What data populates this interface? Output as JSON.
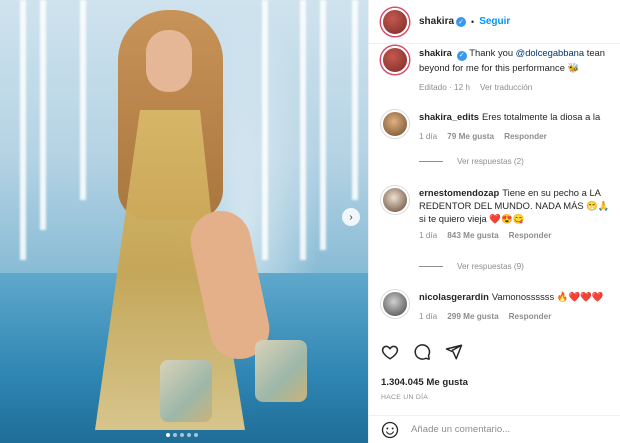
{
  "post": {
    "username": "shakira",
    "follow_label": "Seguir",
    "caption_user": "shakira",
    "caption_prefix": "Thank you ",
    "caption_mention": "@dolcegabbana",
    "caption_suffix": " tean",
    "caption_line2": "beyond for me for this performance 🐝",
    "caption_meta_edited": "Editado · 12 h",
    "caption_meta_translate": "Ver traducción"
  },
  "comments": [
    {
      "username": "shakira_edits",
      "text": "Eres totalmente la diosa a la",
      "time": "1 día",
      "likes": "79 Me gusta",
      "reply_label": "Responder",
      "view_replies": "Ver respuestas (2)"
    },
    {
      "username": "ernestomendozap",
      "text_line1": "Tiene en su pecho a LA",
      "text_line2": "REDENTOR DEL MUNDO. NADA MÁS 😁🙏",
      "text_line3": "si te quiero vieja ❤️😍😋",
      "time": "1 día",
      "likes": "843 Me gusta",
      "reply_label": "Responder",
      "view_replies": "Ver respuestas (9)"
    },
    {
      "username": "nicolasgerardin",
      "text": "Vamonossssss 🔥❤️❤️❤️",
      "time": "1 día",
      "likes": "299 Me gusta",
      "reply_label": "Responder"
    }
  ],
  "stats": {
    "likes": "1.304.045 Me gusta",
    "when": "HACE UN DÍA"
  },
  "composer": {
    "placeholder": "Añade un comentario..."
  },
  "icons": [
    "heart-icon",
    "comment-icon",
    "share-icon",
    "emoji-icon",
    "verified-icon",
    "chevron-right-icon"
  ],
  "colors": {
    "link": "#0095f6",
    "verified": "#3897f0",
    "muted": "#8e8e8e"
  }
}
